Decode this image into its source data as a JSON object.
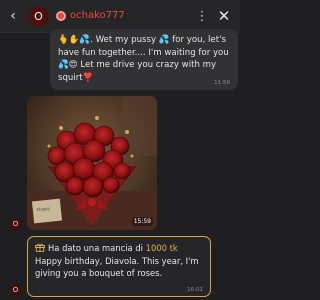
{
  "header": {
    "back_icon": "‹",
    "avatar_letter": "O",
    "username": "ochako777",
    "more_icon": "⋮",
    "close_icon": "✕"
  },
  "messages": [
    {
      "text": "🫰✋💦. Wet my pussy 💦 for you, let's have fun together.... I'm waiting for you 💦😍 Let me drive you crazy with my squirt❣️",
      "time": "11:58"
    }
  ],
  "photo_message": {
    "time": "15:59",
    "avatar_letter": "O"
  },
  "tip_message": {
    "prefix": "Ha dato una mancia di ",
    "amount": "1000 tk",
    "text": "Happy birthday, Diavola. This year, I'm giving you a bouquet of roses.",
    "time": "16:01",
    "avatar_letter": "O",
    "accent_color": "#d8a64a"
  },
  "colors": {
    "username": "#ee4a3a",
    "background": "#1f1f21",
    "bubble": "#323234"
  }
}
